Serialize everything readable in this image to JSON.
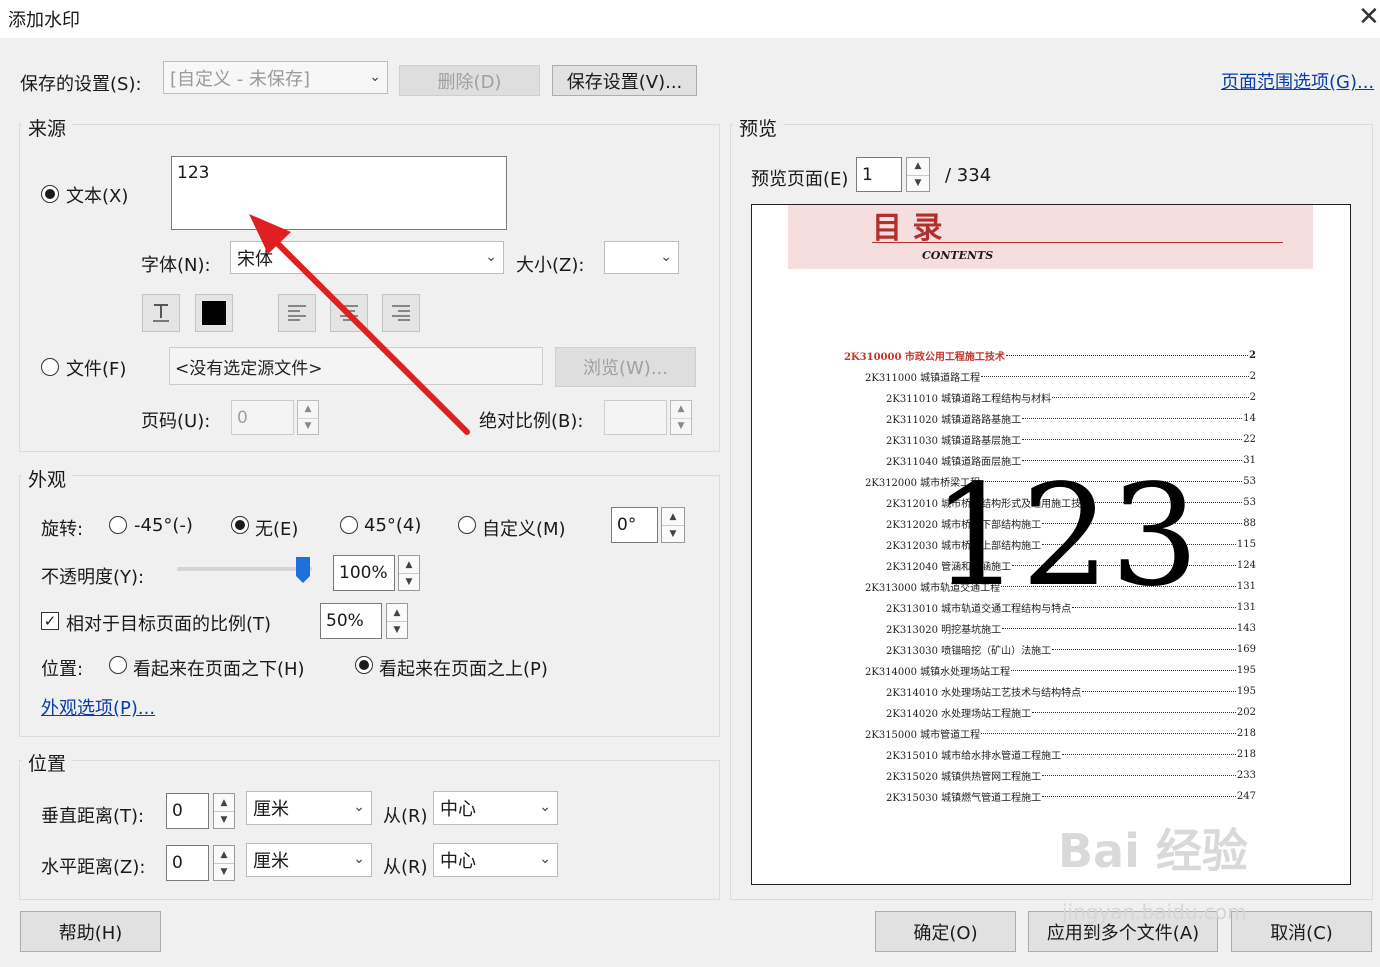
{
  "window": {
    "title": "添加水印",
    "close_glyph": "✕"
  },
  "saved": {
    "label": "保存的设置(S):",
    "value": "[自定义 - 未保存]",
    "delete_label": "删除(D)",
    "save_label": "保存设置(V)...",
    "page_range_link": "页面范围选项(G)..."
  },
  "source": {
    "title": "来源",
    "text_radio": "文本(X)",
    "text_value": "123",
    "font_label": "字体(N):",
    "font_value": "宋体",
    "size_label": "大小(Z):",
    "size_value": "",
    "file_radio": "文件(F)",
    "file_placeholder": "<没有选定源文件>",
    "browse_label": "浏览(W)...",
    "page_label": "页码(U):",
    "page_value": "0",
    "abs_scale_label": "绝对比例(B):",
    "abs_scale_value": "",
    "selected": "text",
    "text_color": "#000000"
  },
  "appearance": {
    "title": "外观",
    "rotation_label": "旋转:",
    "rot_neg45": "-45°(-)",
    "rot_none": "无(E)",
    "rot_45": "45°(4)",
    "rot_custom": "自定义(M)",
    "rot_custom_value": "0°",
    "rotation_selected": "none",
    "opacity_label": "不透明度(Y):",
    "opacity_value": "100%",
    "opacity_level": 1.0,
    "relative_scale_label": "相对于目标页面的比例(T)",
    "relative_scale_checked": true,
    "relative_scale_value": "50%",
    "position_label": "位置:",
    "pos_below": "看起来在页面之下(H)",
    "pos_above": "看起来在页面之上(P)",
    "position_selected": "above",
    "options_link": "外观选项(P)..."
  },
  "position": {
    "title": "位置",
    "vertical_label": "垂直距离(T):",
    "vertical_value": "0",
    "vertical_unit": "厘米",
    "vertical_from_label": "从(R)",
    "vertical_from": "中心",
    "horizontal_label": "水平距离(Z):",
    "horizontal_value": "0",
    "horizontal_unit": "厘米",
    "horizontal_from_label": "从(R)",
    "horizontal_from": "中心"
  },
  "preview": {
    "title": "预览",
    "page_label": "预览页面(E)",
    "page_value": "1",
    "total": "/ 334",
    "doc_heading": "目  录",
    "doc_subheading": "CONTENTS",
    "watermark_text": "123",
    "toc": [
      {
        "text": "2K310000 市政公用工程施工技术",
        "page": "2",
        "level": 0
      },
      {
        "text": "2K311000 城镇道路工程",
        "page": "2",
        "level": 1
      },
      {
        "text": "2K311010 城镇道路工程结构与材料",
        "page": "2",
        "level": 2
      },
      {
        "text": "2K311020 城镇道路路基施工",
        "page": "14",
        "level": 2
      },
      {
        "text": "2K311030 城镇道路基层施工",
        "page": "22",
        "level": 2
      },
      {
        "text": "2K311040 城镇道路面层施工",
        "page": "31",
        "level": 2
      },
      {
        "text": "2K312000 城市桥梁工程",
        "page": "53",
        "level": 1
      },
      {
        "text": "2K312010 城市桥梁结构形式及通用施工技术",
        "page": "53",
        "level": 2
      },
      {
        "text": "2K312020 城市桥梁下部结构施工",
        "page": "88",
        "level": 2
      },
      {
        "text": "2K312030 城市桥梁上部结构施工",
        "page": "115",
        "level": 2
      },
      {
        "text": "2K312040 管涵和箱涵施工",
        "page": "124",
        "level": 2
      },
      {
        "text": "2K313000 城市轨道交通工程",
        "page": "131",
        "level": 1
      },
      {
        "text": "2K313010 城市轨道交通工程结构与特点",
        "page": "131",
        "level": 2
      },
      {
        "text": "2K313020 明挖基坑施工",
        "page": "143",
        "level": 2
      },
      {
        "text": "2K313030 喷锚暗挖（矿山）法施工",
        "page": "169",
        "level": 2
      },
      {
        "text": "2K314000 城镇水处理场站工程",
        "page": "195",
        "level": 1
      },
      {
        "text": "2K314010 水处理场站工艺技术与结构特点",
        "page": "195",
        "level": 2
      },
      {
        "text": "2K314020 水处理场站工程施工",
        "page": "202",
        "level": 2
      },
      {
        "text": "2K315000 城市管道工程",
        "page": "218",
        "level": 1
      },
      {
        "text": "2K315010 城市给水排水管道工程施工",
        "page": "218",
        "level": 2
      },
      {
        "text": "2K315020 城镇供热管网工程施工",
        "page": "233",
        "level": 2
      },
      {
        "text": "2K315030 城镇燃气管道工程施工",
        "page": "247",
        "level": 2
      }
    ]
  },
  "footer": {
    "help": "帮助(H)",
    "ok": "确定(O)",
    "apply_multi": "应用到多个文件(A)",
    "cancel": "取消(C)"
  },
  "overlay": {
    "logo_text": "Bai 经验",
    "logo_url": "jingyan.baidu.com",
    "arrow_color": "#e02020",
    "accent_color": "#c0392b"
  }
}
